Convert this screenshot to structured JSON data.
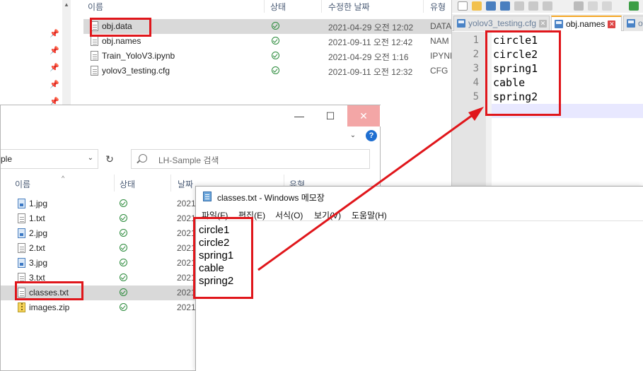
{
  "explorer_top": {
    "columns": {
      "name": "이름",
      "status": "상태",
      "modified": "수정한 날짜",
      "type": "유형"
    },
    "files": [
      {
        "name": "obj.data",
        "modified": "2021-04-29 오전 12:02",
        "type": "DATA",
        "icon": "file-icon"
      },
      {
        "name": "obj.names",
        "modified": "2021-09-11 오전 12:42",
        "type": "NAM",
        "icon": "file-icon"
      },
      {
        "name": "Train_YoloV3.ipynb",
        "modified": "2021-04-29 오전 1:16",
        "type": "IPYNB",
        "icon": "file-icon"
      },
      {
        "name": "yolov3_testing.cfg",
        "modified": "2021-09-11 오전 12:32",
        "type": "CFG",
        "icon": "file-icon"
      }
    ]
  },
  "notepadpp": {
    "tabs": [
      {
        "label": "yolov3_testing.cfg",
        "active": false
      },
      {
        "label": "obj.names",
        "active": true
      },
      {
        "label": "ob",
        "active": false
      }
    ],
    "line_numbers": [
      "1",
      "2",
      "3",
      "4",
      "5"
    ],
    "lines": [
      "circle1",
      "circle2",
      "spring1",
      "cable",
      "spring2"
    ]
  },
  "explorer_main": {
    "window_buttons": {
      "minimize": "—",
      "maximize": "☐",
      "close": "✕"
    },
    "help": "?",
    "address_text": "ple",
    "search_placeholder": "LH-Sample 검색",
    "columns": {
      "name": "이름",
      "status": "상태",
      "date": "날짜",
      "type": "유형"
    },
    "files": [
      {
        "name": "1.jpg",
        "date": "2021",
        "icon": "image-file-icon"
      },
      {
        "name": "1.txt",
        "date": "2021",
        "icon": "text-file-icon"
      },
      {
        "name": "2.jpg",
        "date": "2021",
        "icon": "image-file-icon"
      },
      {
        "name": "2.txt",
        "date": "2021",
        "icon": "text-file-icon"
      },
      {
        "name": "3.jpg",
        "date": "2021",
        "icon": "image-file-icon"
      },
      {
        "name": "3.txt",
        "date": "2021",
        "icon": "text-file-icon"
      },
      {
        "name": "classes.txt",
        "date": "2021",
        "icon": "text-file-icon"
      },
      {
        "name": "images.zip",
        "date": "2021",
        "icon": "zip-file-icon"
      }
    ]
  },
  "notepad": {
    "title": "classes.txt - Windows 메모장",
    "menu": [
      "파일(F)",
      "편집(E)",
      "서식(O)",
      "보기(V)",
      "도움말(H)"
    ],
    "lines": [
      "circle1",
      "circle2",
      "spring1",
      "cable",
      "spring2"
    ]
  },
  "colors": {
    "annotation_red": "#e0161b",
    "check_green": "#2a8a3a",
    "selection": "#d9d9d9"
  }
}
